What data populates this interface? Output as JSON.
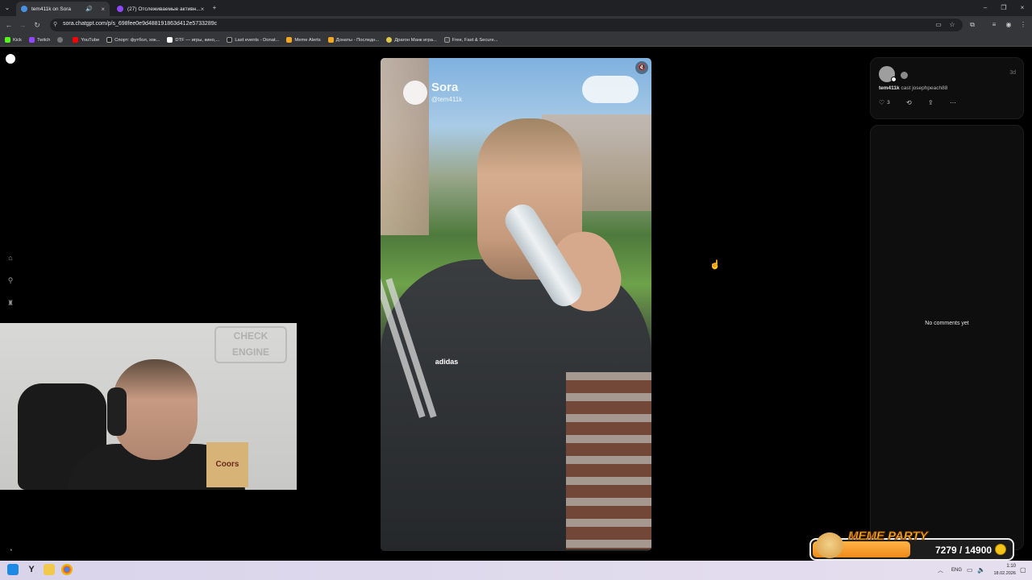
{
  "browser": {
    "tabs": [
      {
        "title": "tem411k on Sora",
        "active": true,
        "favicon_color": "#4a90e2"
      },
      {
        "title": "(27) Отслеживаемые активн...",
        "active": false,
        "favicon_color": "#9146ff"
      }
    ],
    "new_tab_icon": "+",
    "url": "sora.chatgpt.com/p/s_698fee0e9d488191863d412e5733289c",
    "bookmarks": [
      {
        "label": "Kick",
        "color": "#53fc18"
      },
      {
        "label": "Twitch",
        "color": "#9146ff"
      },
      {
        "label": "",
        "color": "#777777"
      },
      {
        "label": "YouTube",
        "color": "#ff0000"
      },
      {
        "label": "Спорт: футбол, хок...",
        "color": "#1e1e1e"
      },
      {
        "label": "DTF — игры, кино,...",
        "color": "#ffffff"
      },
      {
        "label": "Last events - Donat...",
        "color": "#222222"
      },
      {
        "label": "Meme Alerts",
        "color": "#f5a623"
      },
      {
        "label": "Донаты - Последн...",
        "color": "#f5a623"
      },
      {
        "label": "Драгон Манк игра...",
        "color": "#e0c84a"
      },
      {
        "label": "Free, Fast & Secure...",
        "color": "#444444"
      }
    ]
  },
  "video": {
    "watermark_title": "Sora",
    "watermark_handle": "@tem411k",
    "shirt_brand": "adidas"
  },
  "webcam": {
    "sign_text": "CHECK ENGINE",
    "box_text": "Coors"
  },
  "post": {
    "author": "tem411k",
    "cast_text": "cast josephpeach88",
    "time": "3d",
    "likes": "3"
  },
  "comments": {
    "empty_text": "No comments yet"
  },
  "meme_party": {
    "title": "MEME PARTY",
    "count": "7279 / 14900",
    "progress": 0.49
  },
  "taskbar": {
    "lang": "ENG",
    "time": "1:10",
    "date": "18.02.2026"
  }
}
